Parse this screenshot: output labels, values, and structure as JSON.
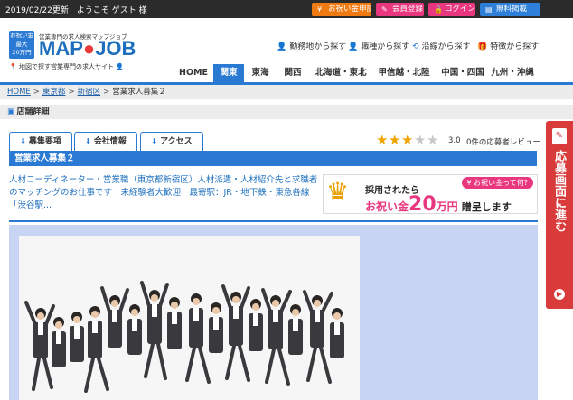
{
  "topbar": {
    "greeting": "2019/02/22更新　ようこそ ゲスト 様",
    "buttons": [
      {
        "label": "お祝い金申請",
        "icon": "yen-icon"
      },
      {
        "label": "会員登録",
        "icon": "pencil-icon"
      },
      {
        "label": "ログイン",
        "icon": "lock-icon"
      },
      {
        "label": "無料掲載",
        "icon": "document-icon"
      }
    ]
  },
  "logo": {
    "badge": [
      "お祝い金",
      "最大",
      "20万円"
    ],
    "subtitle": "営業専門の求人検索マップジョブ",
    "name_left": "MAP",
    "name_right": "JOB",
    "tagline": "地図で探す営業専門の求人サイト"
  },
  "search_nav": [
    {
      "label": "勤務地から探す",
      "icon": "map-pin-icon"
    },
    {
      "label": "職種から探す",
      "icon": "person-icon"
    },
    {
      "label": "沿線から探す",
      "icon": "train-icon"
    },
    {
      "label": "特徴から探す",
      "icon": "gift-icon"
    }
  ],
  "regions": [
    {
      "label": "HOME",
      "active": false
    },
    {
      "label": "関東",
      "active": true
    },
    {
      "label": "東海",
      "active": false
    },
    {
      "label": "関西",
      "active": false
    },
    {
      "label": "北海道・東北",
      "active": false
    },
    {
      "label": "甲信越・北陸",
      "active": false
    },
    {
      "label": "中国・四国",
      "active": false
    },
    {
      "label": "九州・沖縄",
      "active": false
    }
  ],
  "breadcrumb": [
    "HOME",
    "東京都",
    "新宿区",
    "営業求人募集２"
  ],
  "section": {
    "label": "店舗詳細",
    "icon": "shop-icon"
  },
  "tabs": [
    {
      "label": "募集要項"
    },
    {
      "label": "会社情報"
    },
    {
      "label": "アクセス"
    }
  ],
  "rating": {
    "stars": 3,
    "max": 5,
    "score": "3.0",
    "reviews": "0件の応募者レビュー"
  },
  "job": {
    "title": "営業求人募集２",
    "lead": "人材コーディネーター・営業職（東京都新宿区）人材派遣・人材紹介先と求職者のマッチングのお仕事です　未経験者大歓迎　最寄駅：JR・地下鉄・東急各線「渋谷駅..."
  },
  "reward_banner": {
    "line1": "採用されたら",
    "line2_pre": "お祝い金",
    "amount": "20",
    "unit": "万円",
    "suffix": "贈呈します",
    "pill": "¥ お祝い金って何?"
  },
  "side_banner": {
    "text": "応募画面に進む"
  },
  "colors": {
    "accent": "#2a7ad3",
    "pink": "#e8377e",
    "orange": "#f07a12",
    "red": "#d93a3a"
  }
}
